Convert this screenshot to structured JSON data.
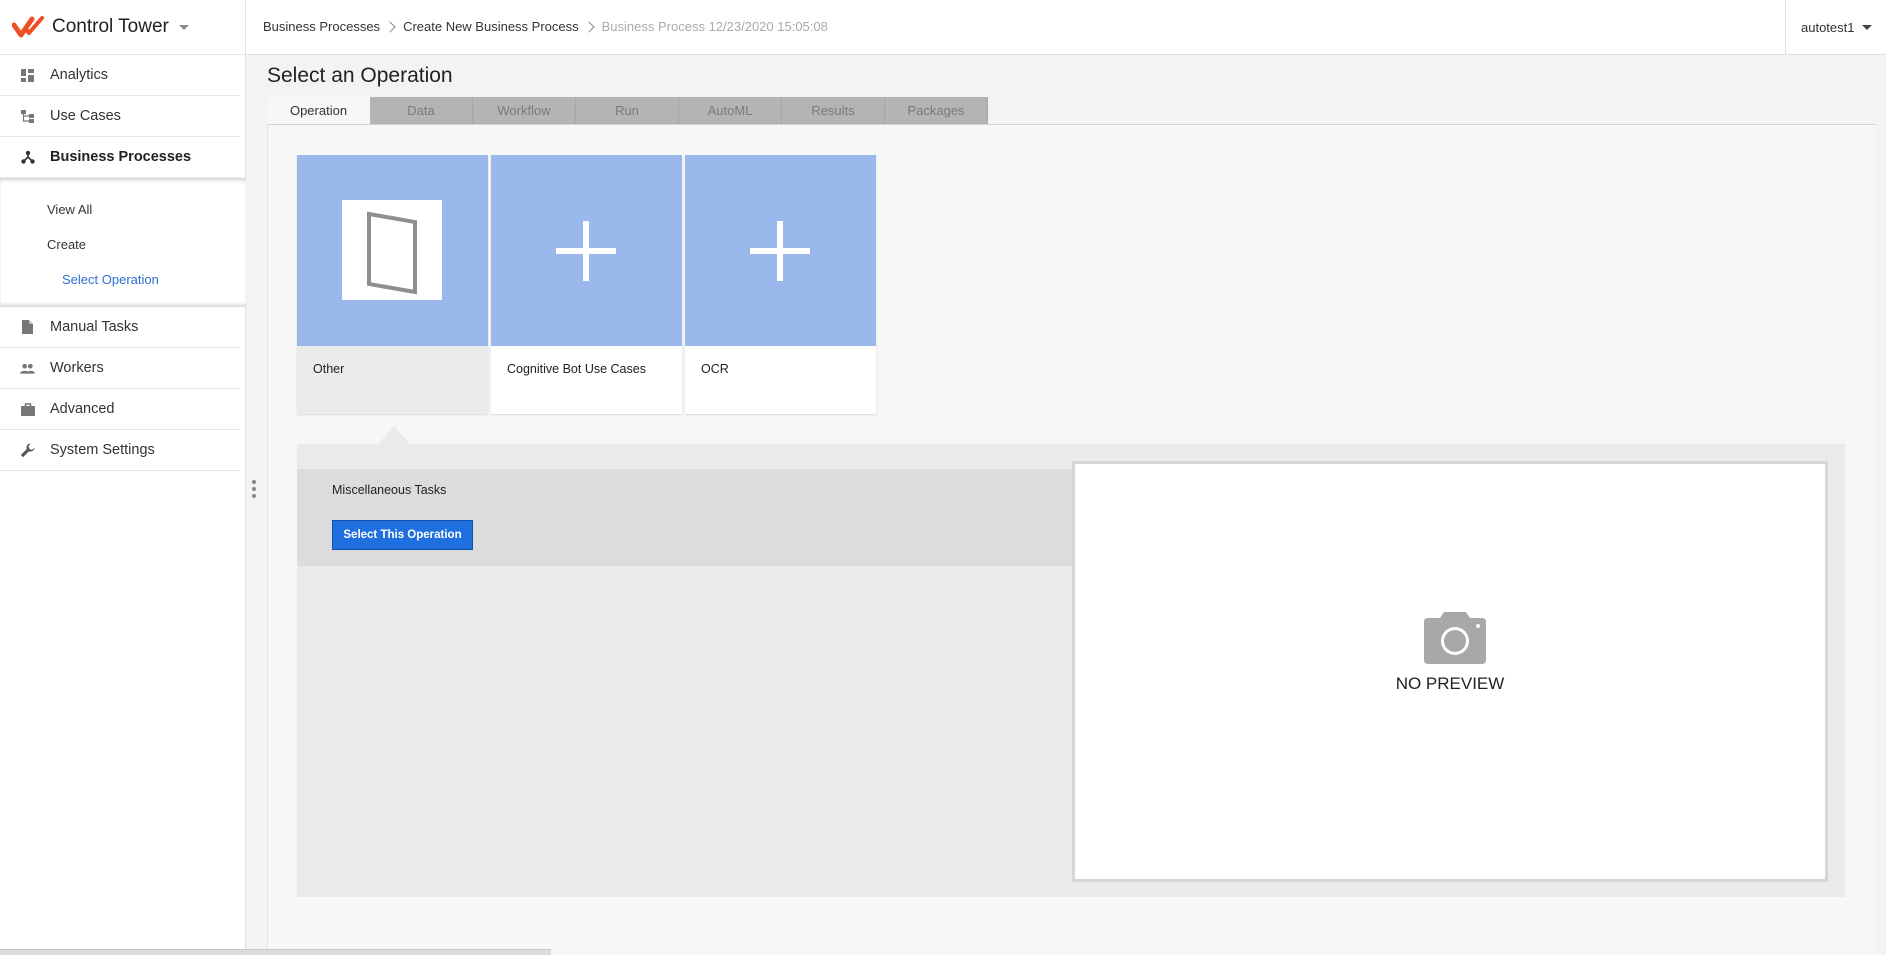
{
  "app": {
    "title": "Control Tower",
    "brand_color": "#f04e23"
  },
  "sidebar": {
    "items": [
      {
        "label": "Analytics",
        "icon": "dashboard-icon"
      },
      {
        "label": "Use Cases",
        "icon": "hierarchy-icon"
      },
      {
        "label": "Business Processes",
        "icon": "network-icon",
        "active": true
      }
    ],
    "subitems": [
      {
        "label": "View All"
      },
      {
        "label": "Create"
      },
      {
        "label": "Select Operation",
        "active": true
      }
    ],
    "items_after": [
      {
        "label": "Manual Tasks",
        "icon": "document-icon"
      },
      {
        "label": "Workers",
        "icon": "people-icon"
      },
      {
        "label": "Advanced",
        "icon": "briefcase-icon"
      },
      {
        "label": "System Settings",
        "icon": "wrench-icon"
      }
    ]
  },
  "breadcrumb": {
    "items": [
      "Business Processes",
      "Create New Business Process",
      "Business Process 12/23/2020 15:05:08"
    ]
  },
  "user": {
    "name": "autotest1"
  },
  "main": {
    "title": "Select an Operation",
    "tabs": [
      "Operation",
      "Data",
      "Workflow",
      "Run",
      "AutoML",
      "Results",
      "Packages"
    ],
    "active_tab": "Operation",
    "cards": [
      {
        "label": "Other",
        "icon": "document-icon",
        "selected": true
      },
      {
        "label": "Cognitive Bot Use Cases",
        "icon": "plus-icon"
      },
      {
        "label": "OCR",
        "icon": "plus-icon"
      }
    ],
    "detail": {
      "title": "Miscellaneous Tasks",
      "button_label": "Select This Operation",
      "preview_text": "NO PREVIEW"
    }
  },
  "colors": {
    "card_thumb": "#9bb8ec",
    "primary_button": "#1f6fde",
    "link_active": "#2e6fd6"
  }
}
